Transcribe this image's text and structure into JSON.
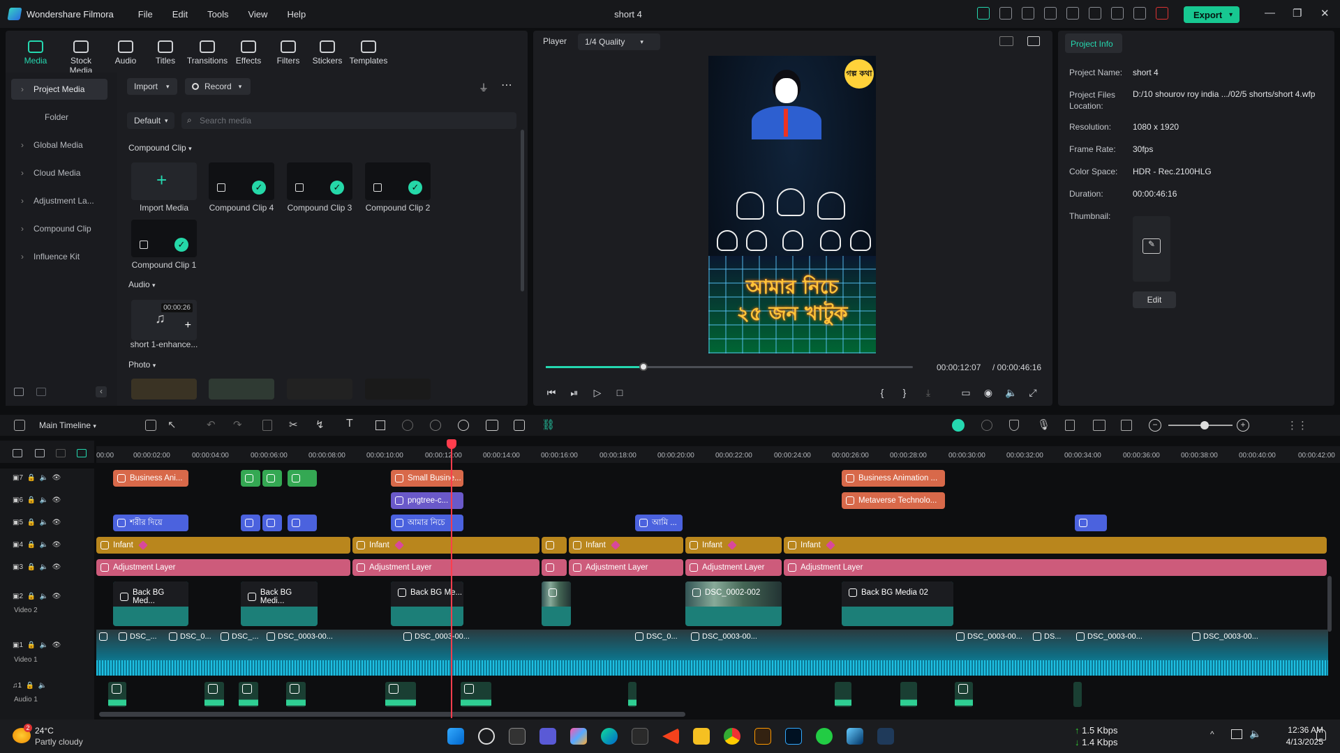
{
  "app": {
    "name": "Wondershare Filmora",
    "doc_title": "short 4",
    "export_label": "Export"
  },
  "menu": [
    "File",
    "Edit",
    "Tools",
    "View",
    "Help"
  ],
  "tabs": [
    {
      "label": "Media",
      "icon": "media-icon",
      "active": true
    },
    {
      "label": "Stock Media",
      "icon": "stock-media-icon"
    },
    {
      "label": "Audio",
      "icon": "music-note-icon"
    },
    {
      "label": "Titles",
      "icon": "text-t-icon"
    },
    {
      "label": "Transitions",
      "icon": "transitions-icon"
    },
    {
      "label": "Effects",
      "icon": "effects-icon"
    },
    {
      "label": "Filters",
      "icon": "filters-icon"
    },
    {
      "label": "Stickers",
      "icon": "stickers-icon"
    },
    {
      "label": "Templates",
      "icon": "templates-icon"
    }
  ],
  "sidebar": {
    "items": [
      "Project Media",
      "Folder",
      "Global Media",
      "Cloud Media",
      "Adjustment La...",
      "Compound Clip",
      "Influence Kit"
    ]
  },
  "media": {
    "import_label": "Import",
    "record_label": "Record",
    "sort_label": "Default",
    "search_placeholder": "Search media",
    "section_compound": "Compound Clip",
    "section_audio": "Audio",
    "section_photo": "Photo",
    "items": [
      "Import Media",
      "Compound Clip 4",
      "Compound Clip 3",
      "Compound Clip 2",
      "Compound Clip 1"
    ],
    "audio_item": {
      "name": "short 1-enhance...",
      "duration": "00:00:26"
    }
  },
  "player": {
    "label": "Player",
    "quality": "1/4 Quality",
    "current": "00:00:12:07",
    "total": "/ 00:00:46:16",
    "progress_fraction": 0.267,
    "overlay_text_line1": "আমার নিচে",
    "overlay_text_line2": "২৫ জন খাটুক",
    "badge_text": "গল্প কথা"
  },
  "project_info": {
    "tab": "Project Info",
    "rows": [
      {
        "k": "Project Name:",
        "v": "short 4"
      },
      {
        "k": "Project Files Location:",
        "v": "D:/10 shourov roy india .../02/5 shorts/short 4.wfp"
      },
      {
        "k": "Resolution:",
        "v": "1080 x 1920"
      },
      {
        "k": "Frame Rate:",
        "v": "30fps"
      },
      {
        "k": "Color Space:",
        "v": "HDR - Rec.2100HLG"
      },
      {
        "k": "Duration:",
        "v": "00:00:46:16"
      },
      {
        "k": "Thumbnail:",
        "v": ""
      }
    ],
    "edit_label": "Edit"
  },
  "timeline": {
    "name": "Main Timeline",
    "ticks": [
      "00:00",
      "00:00:02:00",
      "00:00:04:00",
      "00:00:06:00",
      "00:00:08:00",
      "00:00:10:00",
      "00:00:12:00",
      "00:00:14:00",
      "00:00:16:00",
      "00:00:18:00",
      "00:00:20:00",
      "00:00:22:00",
      "00:00:24:00",
      "00:00:26:00",
      "00:00:28:00",
      "00:00:30:00",
      "00:00:32:00",
      "00:00:34:00",
      "00:00:36:00",
      "00:00:38:00",
      "00:00:40:00",
      "00:00:42:00"
    ],
    "track_labels": {
      "v2": "Video 2",
      "v1": "Video 1",
      "a1": "Audio 1"
    },
    "clips": {
      "t7": [
        "Business Ani...",
        "Small Busine...",
        "Business Animation ..."
      ],
      "t6": [
        "pngtree-c...",
        "Metaverse Technolo..."
      ],
      "t5": [
        "শরীর দিয়ে",
        "আমার নিচে",
        "আমি ..."
      ],
      "t4": [
        "Infant",
        "Infant",
        "Infant",
        "Infant",
        "Infant"
      ],
      "t3": [
        "Adjustment Layer",
        "Adjustment Layer",
        "Adjustment Layer",
        "Adjustment Layer",
        "Adjustment Layer"
      ],
      "t2": [
        "Back BG Med...",
        "Back BG Medi...",
        "Back BG Me...",
        "DSC_0002-002",
        "Back BG Media 02"
      ],
      "t1": [
        "DSC_...",
        "DSC_0...",
        "DSC_...",
        "DSC_0003-00...",
        "DSC_0003-00...",
        "DSC_0...",
        "DSC_0003-00...",
        "DSC_0003-00...",
        "DS...",
        "DSC_0003-00...",
        "DSC_0003-00..."
      ]
    }
  },
  "taskbar": {
    "weather_temp": "24°C",
    "weather_desc": "Partly cloudy",
    "weather_badge": "2",
    "net_up": "1.5 Kbps",
    "net_down": "1.4 Kbps",
    "time": "12:36 AM",
    "date": "4/13/2025"
  },
  "colors": {
    "accent": "#25d8b0",
    "export": "#17c891",
    "playhead": "#ff3d4d"
  }
}
